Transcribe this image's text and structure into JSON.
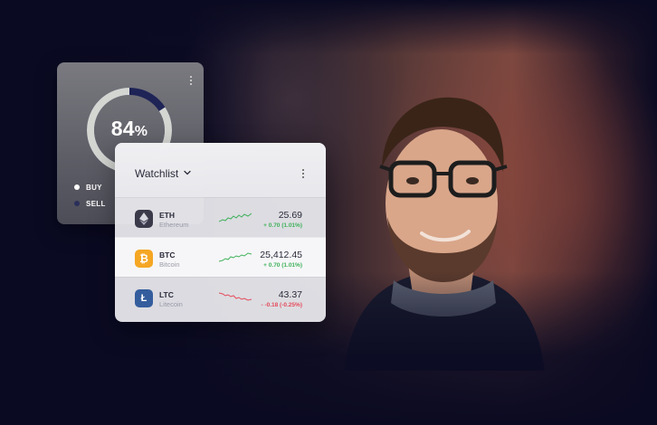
{
  "gauge": {
    "value": "84",
    "unit": "%",
    "percent": 84,
    "colors": {
      "ring": "#d4d6d2",
      "gap": "#1e2456",
      "card": "#6b6b73"
    },
    "legend": [
      {
        "label": "BUY",
        "color": "#ffffff"
      },
      {
        "label": "SELL",
        "color": "#2a2f5a"
      }
    ]
  },
  "watchlist": {
    "title": "Watchlist",
    "rows": [
      {
        "symbol": "ETH",
        "name": "Ethereum",
        "price": "25.69",
        "change": "+ 0.70 (1.01%)",
        "trend": "up",
        "icon": "ethereum-icon",
        "icon_color": "#3a3a4a"
      },
      {
        "symbol": "BTC",
        "name": "Bitcoin",
        "price": "25,412.45",
        "change": "+ 0.70 (1.01%)",
        "trend": "up",
        "icon": "bitcoin-icon",
        "icon_color": "#f5a623"
      },
      {
        "symbol": "LTC",
        "name": "Litecoin",
        "price": "43.37",
        "change": "- -0.18 (-0.25%)",
        "trend": "down",
        "icon": "litecoin-icon",
        "icon_color": "#345d9d"
      }
    ]
  },
  "colors": {
    "up": "#3fb15a",
    "down": "#e64a5a",
    "background": "#0a0a22"
  }
}
